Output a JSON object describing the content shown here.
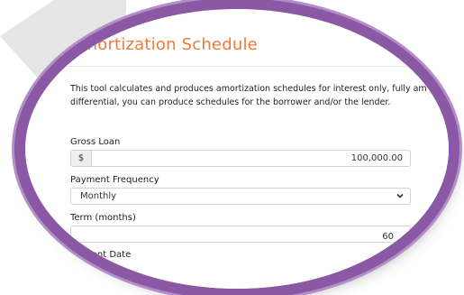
{
  "form": {
    "title": "Amortization Schedule",
    "description_line1": "This tool calculates and produces amortization schedules for interest only, fully am",
    "description_line2": "differential, you can produce schedules for the borrower and/or the lender.",
    "gross_loan": {
      "label": "Gross Loan",
      "prefix": "$",
      "value": "100,000.00"
    },
    "payment_frequency": {
      "label": "Payment Frequency",
      "value": "Monthly"
    },
    "term": {
      "label": "Term (months)",
      "value": "60"
    },
    "first_payment": {
      "label": "ment Date"
    }
  },
  "colors": {
    "title": "#f07a3a",
    "ring": "#8a58a4"
  },
  "icons": {
    "dropdown": "chevron-down-icon",
    "radio": "radio-icon"
  }
}
